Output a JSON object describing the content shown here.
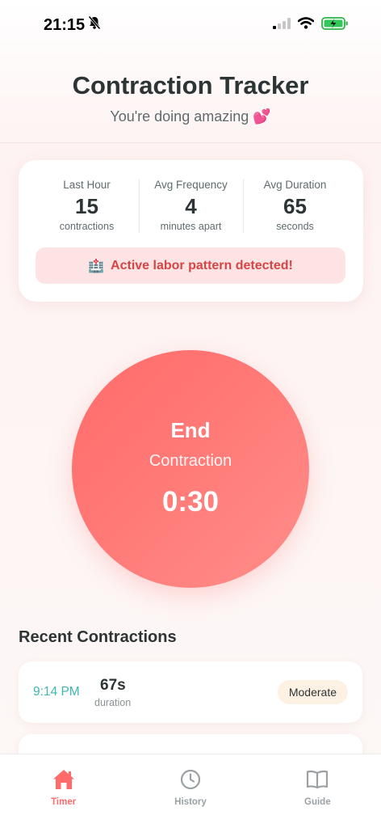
{
  "status_bar": {
    "time": "21:15"
  },
  "header": {
    "title": "Contraction Tracker",
    "subtitle": "You're doing amazing 💕"
  },
  "stats": [
    {
      "label": "Last Hour",
      "value": "15",
      "unit": "contractions"
    },
    {
      "label": "Avg Frequency",
      "value": "4",
      "unit": "minutes apart"
    },
    {
      "label": "Avg Duration",
      "value": "65",
      "unit": "seconds"
    }
  ],
  "alert": {
    "icon": "🏥",
    "text": "Active labor pattern detected!"
  },
  "timer": {
    "action": "End",
    "subtitle": "Contraction",
    "elapsed": "0:30"
  },
  "recent": {
    "title": "Recent Contractions",
    "items": [
      {
        "time": "9:14 PM",
        "duration": "67s",
        "duration_label": "duration",
        "intensity": "Moderate"
      }
    ]
  },
  "tabs": [
    {
      "label": "Timer",
      "icon": "home-icon",
      "active": true
    },
    {
      "label": "History",
      "icon": "clock-icon",
      "active": false
    },
    {
      "label": "Guide",
      "icon": "book-icon",
      "active": false
    }
  ],
  "colors": {
    "accent": "#ff6b6b",
    "teal": "#3fb8b0",
    "alert_bg": "#fde3e3",
    "alert_text": "#d64545"
  }
}
